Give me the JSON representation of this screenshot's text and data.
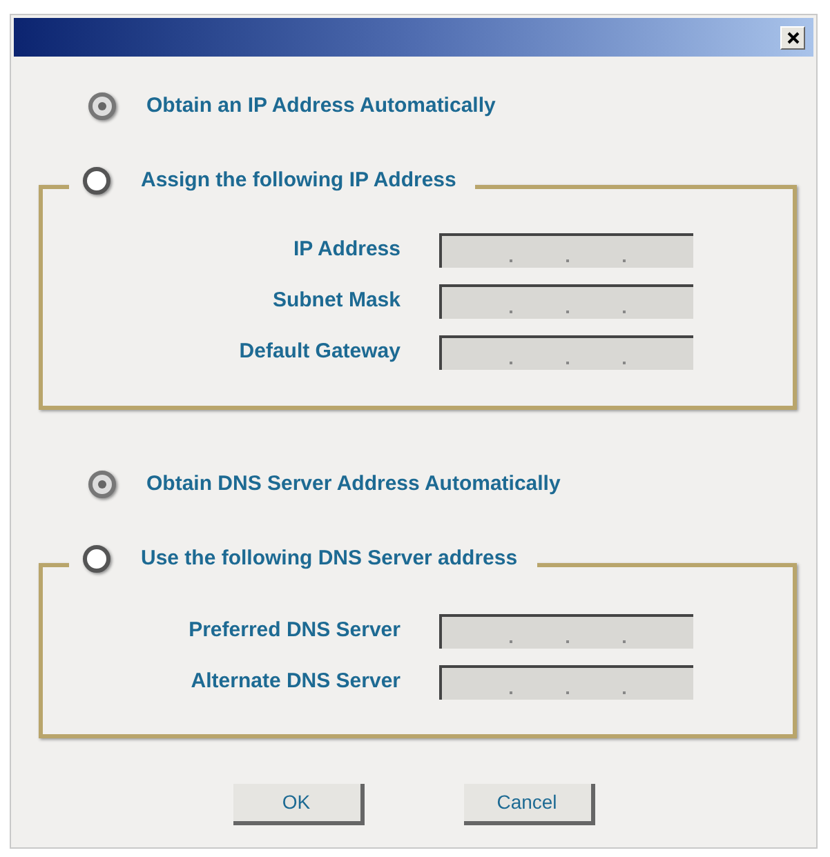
{
  "sections": [
    {
      "options": [
        {
          "label": "Obtain an IP Address Automatically",
          "selected": true
        },
        {
          "label": "Assign the following IP Address",
          "selected": false
        }
      ],
      "fields": [
        {
          "label": "IP Address",
          "disabled": true
        },
        {
          "label": "Subnet Mask",
          "disabled": true
        },
        {
          "label": "Default Gateway",
          "disabled": true
        }
      ]
    },
    {
      "options": [
        {
          "label": "Obtain DNS Server Address Automatically",
          "selected": true
        },
        {
          "label": "Use the following DNS Server address",
          "selected": false
        }
      ],
      "fields": [
        {
          "label": "Preferred DNS Server",
          "disabled": true
        },
        {
          "label": "Alternate DNS Server",
          "disabled": true
        }
      ]
    }
  ],
  "buttons": [
    "OK",
    "Cancel"
  ]
}
